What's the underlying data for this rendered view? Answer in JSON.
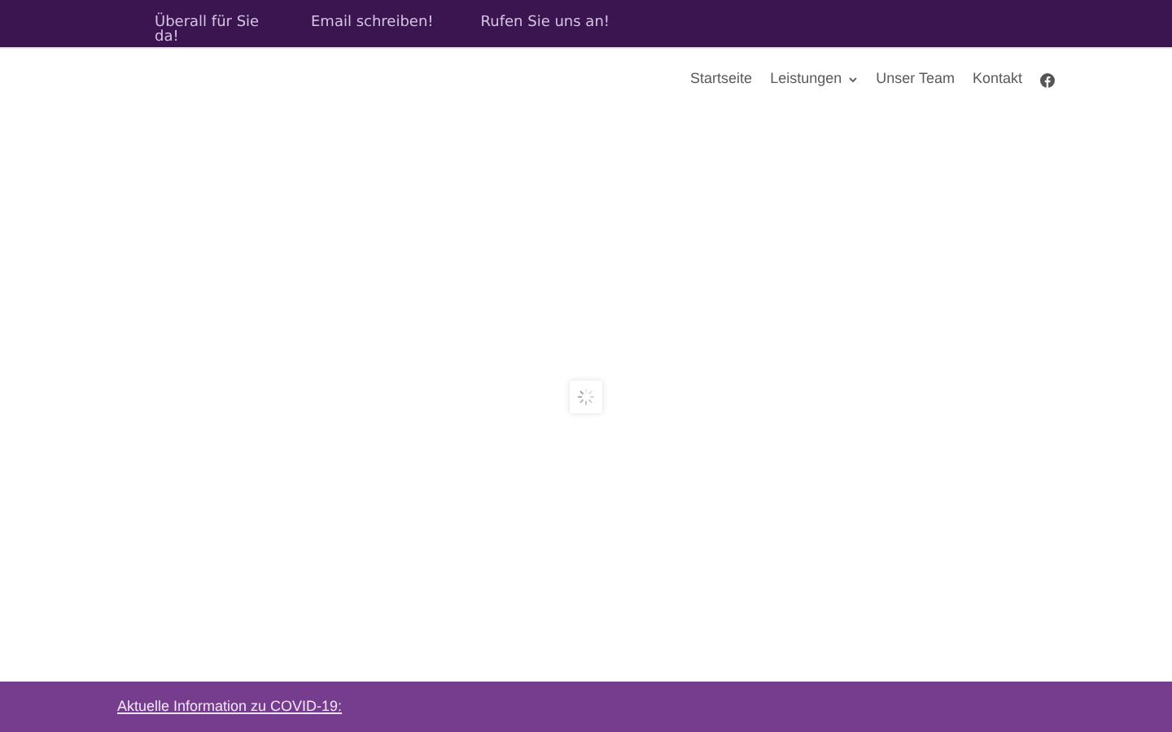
{
  "topbar": {
    "items": [
      "Überall für Sie da!",
      "Email schreiben!",
      "Rufen Sie uns an!"
    ]
  },
  "nav": {
    "items": [
      {
        "label": "Startseite",
        "kind": "link"
      },
      {
        "label": "Leistungen",
        "kind": "dropdown"
      },
      {
        "label": "Unser Team",
        "kind": "link"
      },
      {
        "label": "Kontakt",
        "kind": "link"
      },
      {
        "kind": "facebook"
      }
    ]
  },
  "notice": {
    "link": "Aktuelle Information zu COVID-19:"
  }
}
